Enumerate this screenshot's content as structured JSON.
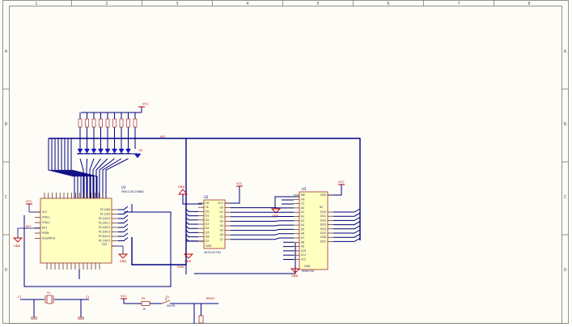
{
  "frame": {
    "col_numbers": [
      "1",
      "2",
      "3",
      "4",
      "5",
      "6",
      "7",
      "8"
    ],
    "row_letters": [
      "A",
      "B",
      "C",
      "D"
    ]
  },
  "power": {
    "vcc": "VCC",
    "gnd": "GND"
  },
  "u1": {
    "ref": "U1",
    "part": "P89C51RC2HBBD",
    "left_pins": [
      "VCC",
      "XTAL1",
      "XTAL2",
      "RST",
      "PSEN",
      "ALE/PROG"
    ],
    "right_pins": [
      "P2.0/A8",
      "P2.1/A9",
      "P2.2/A10",
      "P2.3/A11",
      "P2.4/A12",
      "P2.5/A13",
      "P2.6/A14",
      "P2.7/A15"
    ],
    "vss": "VSS"
  },
  "u2": {
    "ref": "U2",
    "part": "SN74LS373N",
    "left_pins": [
      "OE",
      "LE",
      "D0",
      "D1",
      "D2",
      "D3",
      "D4",
      "D5",
      "D6",
      "D7"
    ],
    "right_pins": [
      "VCC",
      "Q0",
      "Q1",
      "Q2",
      "Q3",
      "Q4",
      "Q5",
      "Q6",
      "Q7"
    ],
    "gnd": "GND"
  },
  "u3": {
    "ref": "U3",
    "part": "HM62256",
    "left_pins": [
      "WE",
      "OE",
      "CS",
      "A0",
      "A1",
      "A2",
      "A3",
      "A4",
      "A5",
      "A6",
      "A7",
      "A8",
      "A9",
      "A10",
      "A11",
      "A12"
    ],
    "right_pins": [
      "VDD",
      "DQ0",
      "DQ1",
      "DQ2",
      "DQ3",
      "DQ4",
      "DQ5",
      "DQ6",
      "DQ7"
    ],
    "gnd": "GND",
    "nc": "NC"
  },
  "net_labels": {
    "ale": "ALE",
    "psen": "PSEN",
    "reset": "RESET",
    "rst": "RST"
  },
  "parts": {
    "crystal": "Y1",
    "c1": "C1",
    "c2": "C2",
    "r9": "R9",
    "r9_value": "1K",
    "s1": "S1",
    "s1_name": "SW-PB",
    "led_group": "D1"
  },
  "colors": {
    "wire": "#000080",
    "net_label": "#c00000",
    "chip_fill": "#ffffc0",
    "chip_border": "#a03030",
    "led": "#1515cc"
  }
}
